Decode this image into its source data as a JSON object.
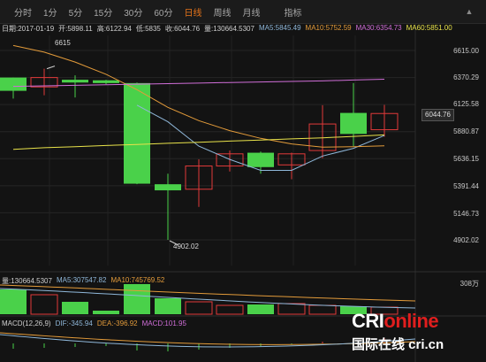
{
  "toolbar": {
    "tabs": [
      {
        "label": "分时",
        "active": false
      },
      {
        "label": "1分",
        "active": false
      },
      {
        "label": "5分",
        "active": false
      },
      {
        "label": "15分",
        "active": false
      },
      {
        "label": "30分",
        "active": false
      },
      {
        "label": "60分",
        "active": false
      },
      {
        "label": "日线",
        "active": true
      },
      {
        "label": "周线",
        "active": false
      },
      {
        "label": "月线",
        "active": false
      }
    ],
    "indicator_label": "指标",
    "collapse_icon": "chevron-up-icon"
  },
  "info": {
    "date": "日期:2017-01-19",
    "open": "开:5898.11",
    "high": "高:6122.94",
    "low": "低:5835",
    "close": "收:6044.76",
    "volume": "量:130664.5307",
    "ma5": "MA5:5845.49",
    "ma10": "MA10:5752.59",
    "ma30": "MA30:6354.73",
    "ma60": "MA60:5851.00"
  },
  "price_axis": [
    "6615.00",
    "6370.29",
    "6125.58",
    "5880.87",
    "5636.15",
    "5391.44",
    "5146.73",
    "4902.02"
  ],
  "last_price_tag": "6044.76",
  "annotations": {
    "high": "6615",
    "low": "4902.02"
  },
  "volume_info": {
    "vol": "量:130664.5307",
    "ma5": "MA5:307547.82",
    "ma10": "MA10:745769.52",
    "axis_top": "308万"
  },
  "macd_info": {
    "title": "MACD(12,26,9)",
    "dif": "DIF:-345.94",
    "dea": "DEA:-396.92",
    "macd": "MACD:101.95"
  },
  "watermark": {
    "brand_part1": "CRI",
    "brand_part2": "online",
    "subtitle": "国际在线 cri.cn"
  },
  "colors": {
    "up": "#e13a3a",
    "down": "#4ad14a",
    "ma5": "#8fb7d9",
    "ma10": "#e39b3a",
    "ma30": "#d06ed8",
    "ma60": "#e8e24a",
    "background": "#131313"
  },
  "chart_data": {
    "type": "candlestick",
    "interval": "daily",
    "ylim": [
      4902.02,
      6615.0
    ],
    "candles": [
      {
        "open": 6370,
        "close": 6250,
        "high": 6370,
        "low": 6180
      },
      {
        "open": 6285,
        "close": 6370,
        "high": 6450,
        "low": 6210
      },
      {
        "open": 6350,
        "close": 6325,
        "high": 6390,
        "low": 6190
      },
      {
        "open": 6345,
        "close": 6320,
        "high": 6350,
        "low": 6310
      },
      {
        "open": 6320,
        "close": 5410,
        "high": 6325,
        "low": 5405
      },
      {
        "open": 5405,
        "close": 5350,
        "high": 5500,
        "low": 4902.02
      },
      {
        "open": 5360,
        "close": 5570,
        "high": 5630,
        "low": 5200
      },
      {
        "open": 5570,
        "close": 5680,
        "high": 5710,
        "low": 5520
      },
      {
        "open": 5690,
        "close": 5560,
        "high": 5700,
        "low": 5500
      },
      {
        "open": 5580,
        "close": 5680,
        "high": 5690,
        "low": 5450
      },
      {
        "open": 5710,
        "close": 5950,
        "high": 6120,
        "low": 5640
      },
      {
        "open": 6050,
        "close": 5860,
        "high": 6320,
        "low": 5750
      },
      {
        "open": 5898.11,
        "close": 6044.76,
        "high": 6122.94,
        "low": 5835
      }
    ],
    "ma_series": [
      {
        "name": "MA5",
        "values": [
          null,
          null,
          null,
          null,
          6120,
          5970,
          5750,
          5630,
          5530,
          5530,
          5660,
          5730,
          5845.49
        ]
      },
      {
        "name": "MA10",
        "values": [
          6660,
          6600,
          6510,
          6400,
          6260,
          6100,
          5980,
          5890,
          5820,
          5770,
          5740,
          5745,
          5752.59
        ]
      },
      {
        "name": "MA30",
        "values": [
          6290,
          6295,
          6300,
          6305,
          6310,
          6315,
          6320,
          6325,
          6330,
          6335,
          6340,
          6348,
          6354.73
        ]
      },
      {
        "name": "MA60",
        "values": [
          5720,
          5735,
          5745,
          5755,
          5765,
          5775,
          5785,
          5795,
          5805,
          5815,
          5825,
          5838,
          5851.0
        ]
      }
    ],
    "volume": {
      "ma5": 307547.82,
      "ma10": 745769.52
    },
    "macd": {
      "dif": -345.94,
      "dea": -396.92,
      "macd": 101.95
    }
  }
}
